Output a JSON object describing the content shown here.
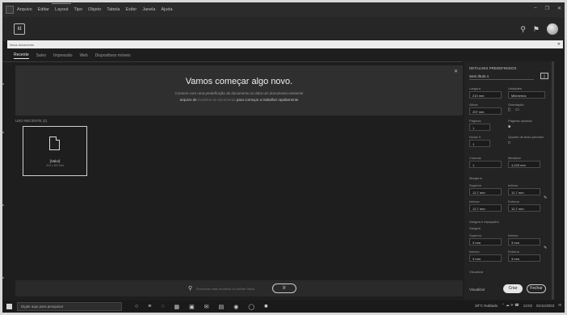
{
  "menubar": {
    "items": [
      "Arquivo",
      "Editar",
      "Layout",
      "Tipo",
      "Objeto",
      "Tabela",
      "Exibir",
      "Janela",
      "Ajuda"
    ],
    "window_controls": [
      "–",
      "❐",
      "✕"
    ]
  },
  "toolbar": {
    "logo_text": "Id"
  },
  "addressbar": {
    "text": "Nova documento",
    "close": "✕"
  },
  "tabs": [
    "Recente",
    "Salvo",
    "Impressão",
    "Web",
    "Dispositivos móveis"
  ],
  "hero": {
    "title": "Vamos começar algo novo.",
    "line1": "Comece com uma predefinição de documento ou abra um documento existente",
    "line2_prefix": "arquivo de",
    "line2_link": "modelos do documento",
    "line2_suffix": "para começar a trabalhar rapidamente",
    "close": "✕"
  },
  "section_label": "USO RECENTE (1)",
  "preset": {
    "name": "[Valor]",
    "size": "210 x 297 mm"
  },
  "bottom": {
    "search_placeholder": "Encontrar mais modelos no Adobe Stock",
    "go_label": "Ir"
  },
  "panel": {
    "heading": "DETALHES PREDEFINIDOS",
    "doc_name": "Sem título-1",
    "save_icon": "⤓",
    "width_label": "Largura",
    "width_value": "210 mm",
    "units_label": "Unidades",
    "units_value": "Milímetros",
    "height_label": "Altura",
    "height_value": "297 mm",
    "orientation_label": "Orientação",
    "pages_label": "Páginas",
    "pages_value": "1",
    "facing_label": "Páginas opostas",
    "start_label": "Iniciar #",
    "start_value": "1",
    "primary_label": "Quadro de texto primário",
    "columns_label": "Colunas",
    "columns_value": "1",
    "gutter_label": "Medianiz",
    "gutter_value": "4,233 mm",
    "margins_label": "Margens",
    "top_label": "Superior",
    "top_value": "12,7 mm",
    "bottom_label": "Inferior",
    "bottom_value": "12,7 mm",
    "inside_label": "Interna",
    "inside_value": "12,7 mm",
    "outside_label": "Externa",
    "outside_value": "12,7 mm",
    "bleed_label": "Sangria e espaçador",
    "bleed_sub": "Sangria",
    "b_top_label": "Superior",
    "b_top_value": "3 mm",
    "b_bottom_label": "Inferior",
    "b_bottom_value": "3 mm",
    "b_inside_label": "Interna",
    "b_inside_value": "3 mm",
    "b_outside_label": "Externa",
    "b_outside_value": "3 mm",
    "preview_label": "Visualizar",
    "cancel_label": "Visualizar",
    "create_label": "Criar",
    "close_label": "Fechar"
  },
  "taskbar": {
    "search_placeholder": "Digite aqui para pesquisar",
    "weather": "28°C Nublado",
    "time": "13:02",
    "date": "01/11/2023"
  }
}
